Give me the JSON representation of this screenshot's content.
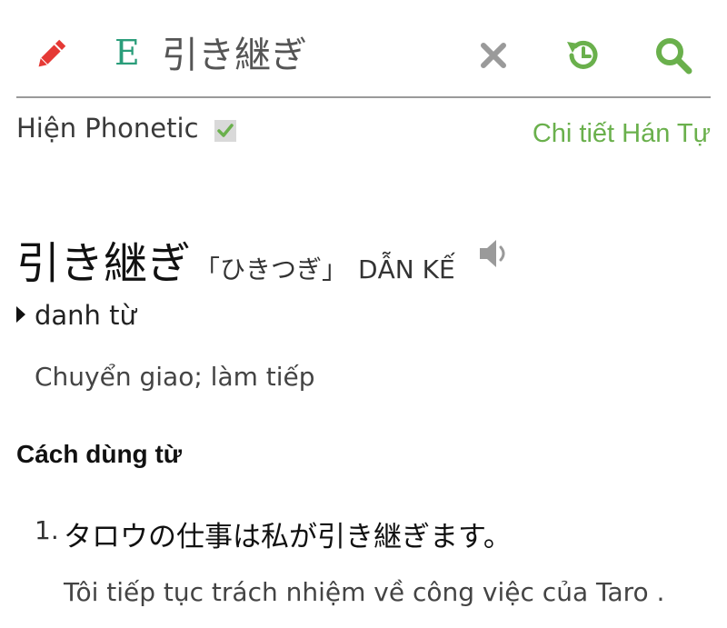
{
  "colors": {
    "accent_green": "#6ab04c",
    "pencil_red": "#e53935",
    "lang_teal": "#2a9d7a",
    "clear_gray": "#9a9a9a"
  },
  "toolbar": {
    "edit_icon": "pencil-icon",
    "language_label": "E",
    "search_value": "引き継ぎ",
    "clear_icon": "close-icon",
    "history_icon": "history-icon",
    "search_icon": "search-icon"
  },
  "options": {
    "phonetic_label": "Hiện Phonetic",
    "phonetic_checked": true,
    "kanji_detail_label": "Chi tiết Hán Tự"
  },
  "entry": {
    "word": "引き継ぎ",
    "reading": "「ひきつぎ」",
    "hanviet": "DẪN KẾ",
    "audio_icon": "speaker-icon",
    "part_of_speech": "danh từ",
    "meaning": "Chuyển giao; làm tiếp"
  },
  "usage": {
    "title": "Cách dùng từ",
    "examples": [
      {
        "number": "1.",
        "japanese": "タロウの仕事は私が引き継ぎます。",
        "vietnamese": "Tôi tiếp tục trách nhiệm về công việc của Taro ."
      }
    ]
  }
}
